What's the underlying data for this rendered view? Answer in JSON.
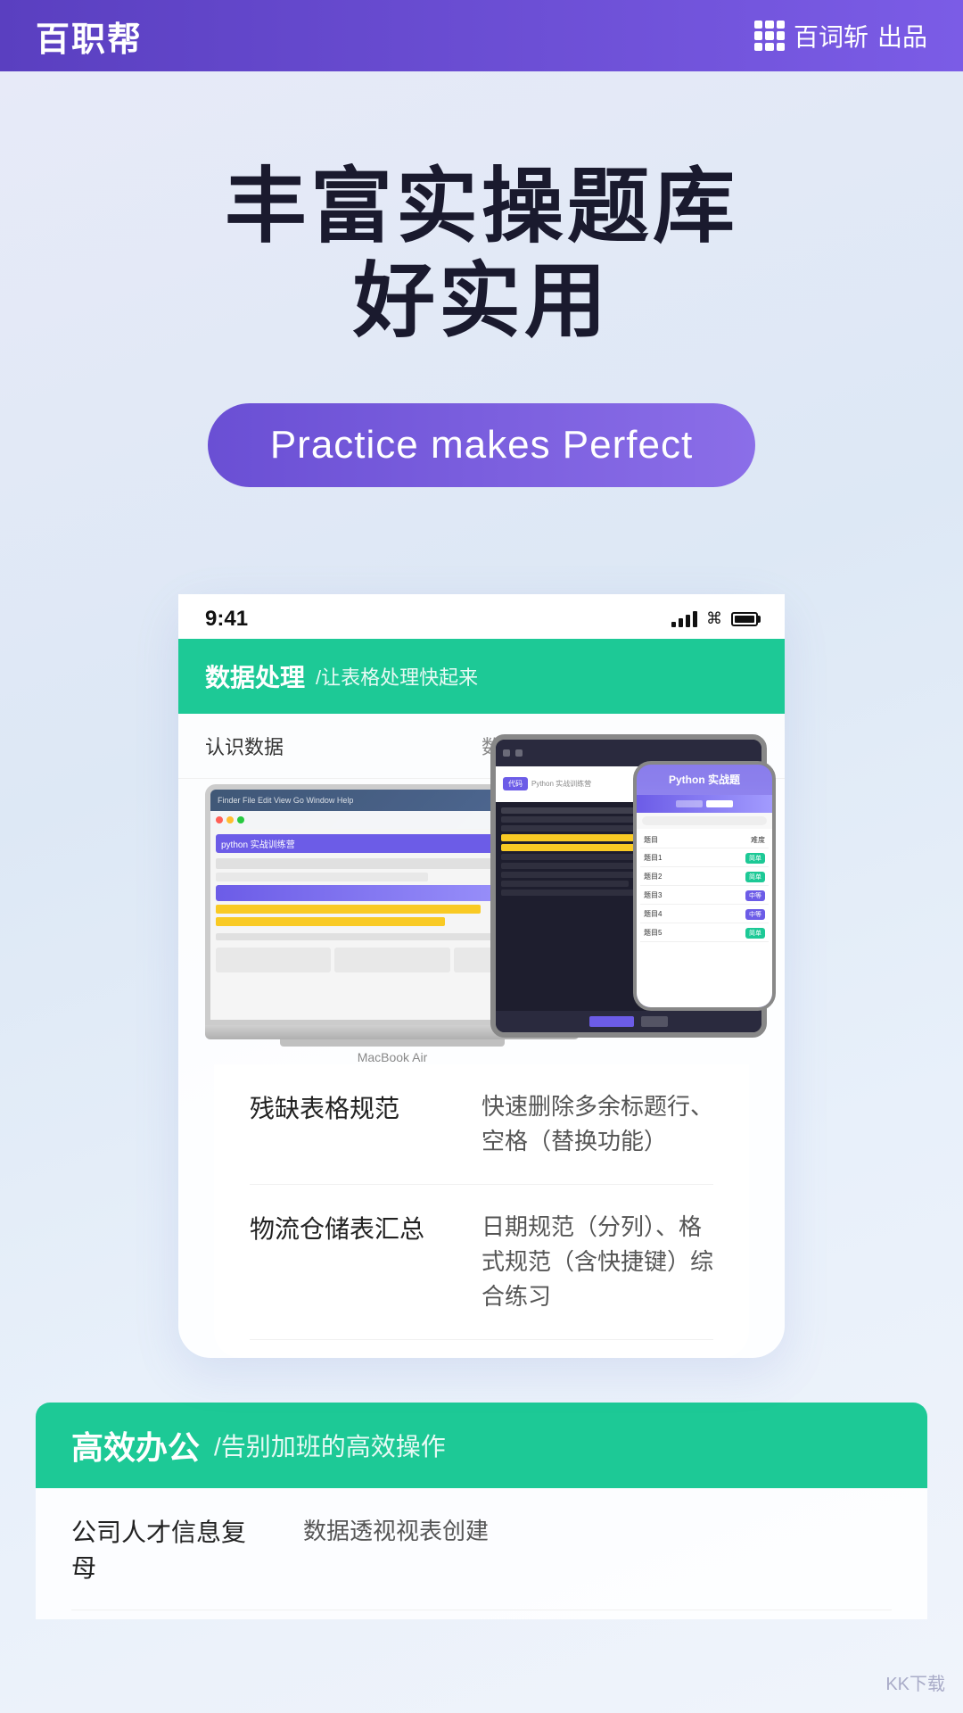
{
  "header": {
    "logo": "百职帮",
    "brand_icon_label": "grid-icon",
    "brand_name": "百词斩",
    "brand_suffix": "出品"
  },
  "hero": {
    "title_line1": "丰富实操题库",
    "title_line2": "好实用",
    "badge": "Practice makes Perfect"
  },
  "phone_mockup": {
    "status_time": "9:41",
    "content_header_title": "数据处理",
    "content_header_sub": "/让表格处理快起来",
    "table_rows": [
      {
        "left": "认识数据",
        "right": "数据类型、粘贴技..."
      }
    ]
  },
  "content_table_rows": [
    {
      "left": "残缺表格规范",
      "right": "快速删除多余标题行、空格（替换功能）"
    },
    {
      "left": "物流仓储表汇总",
      "right": "日期规范（分列）、格式规范（含快捷键）综合练习"
    }
  ],
  "bottom_section": {
    "header_title": "高效办公",
    "header_sub": "/告别加班的高效操作",
    "rows": [
      {
        "left": "公司人才信息复母",
        "right": "数据透视视表创建"
      }
    ]
  },
  "laptop_label": "MacBook Air",
  "watermark": "KK下载"
}
